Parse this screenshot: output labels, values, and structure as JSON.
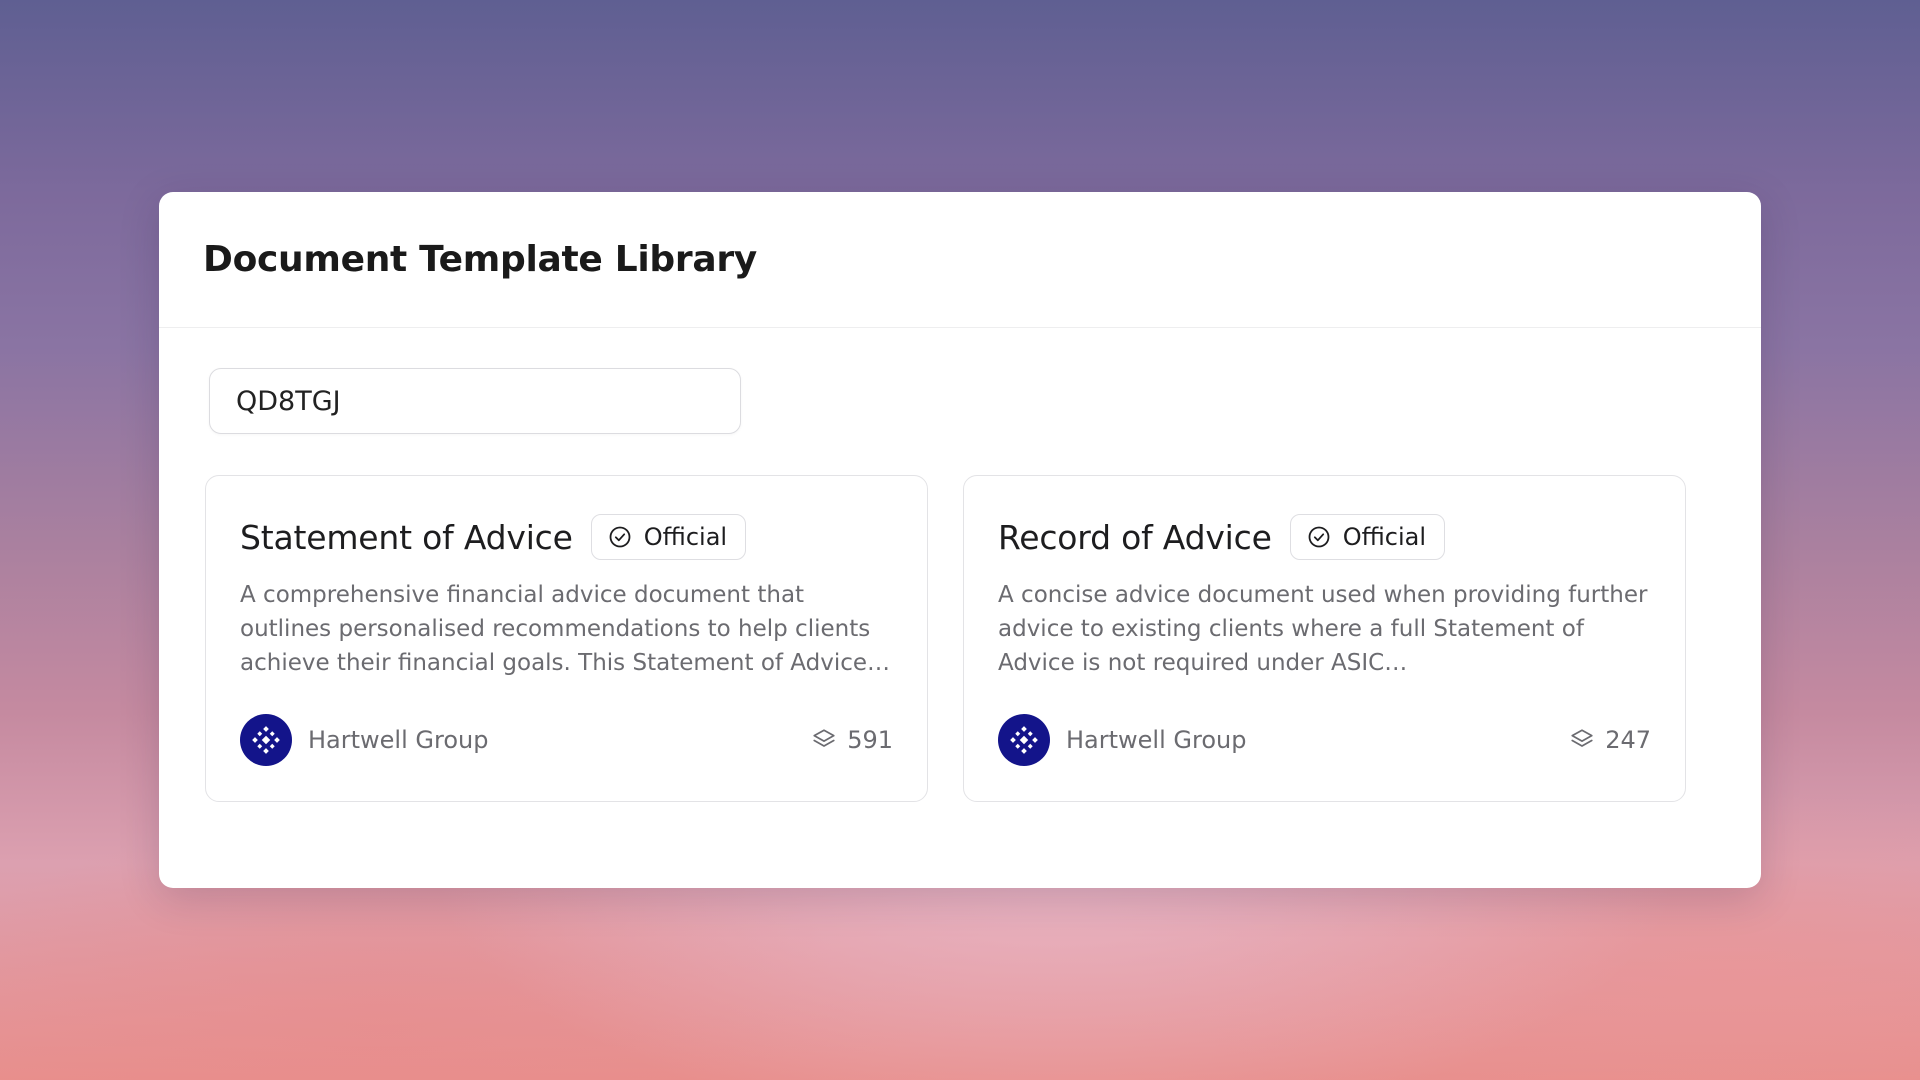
{
  "library": {
    "title": "Document Template Library",
    "search": {
      "value": "QD8TGJ",
      "placeholder": ""
    }
  },
  "templates": [
    {
      "title": "Statement of Advice",
      "badge": "Official",
      "badge_icon": "check-circle-icon",
      "description": "A comprehensive financial advice document that outlines personalised recommendations to help clients achieve their financial goals. This Statement of Advice…",
      "organization": "Hartwell Group",
      "org_icon": "hartwell-logo-icon",
      "usage_icon": "layers-icon",
      "usage_count": "591"
    },
    {
      "title": "Record of Advice",
      "badge": "Official",
      "badge_icon": "check-circle-icon",
      "description": "A concise advice document used when providing further advice to existing clients where a full Statement of Advice is not required under ASIC…",
      "organization": "Hartwell Group",
      "org_icon": "hartwell-logo-icon",
      "usage_icon": "layers-icon",
      "usage_count": "247"
    }
  ],
  "colors": {
    "avatar_bg": "#13148a",
    "muted_text": "#6b6b70",
    "title_text": "#1d1d1f"
  }
}
